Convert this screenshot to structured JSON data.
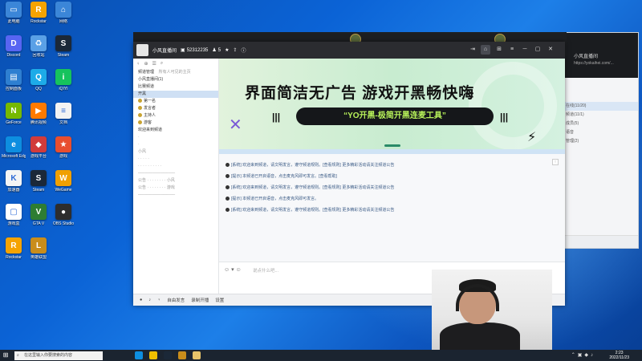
{
  "desktop_icons": [
    {
      "label": "此电脑",
      "color": "#3b86d8",
      "glyph": "▭"
    },
    {
      "label": "Rockstar",
      "color": "#f5a300",
      "glyph": "R"
    },
    {
      "label": "网络",
      "color": "#3b86d8",
      "glyph": "⌂"
    },
    {
      "label": "Discord",
      "color": "#5865f2",
      "glyph": "D"
    },
    {
      "label": "回收站",
      "color": "#5aa0e6",
      "glyph": "♻"
    },
    {
      "label": "Steam",
      "color": "#1b2838",
      "glyph": "S"
    },
    {
      "label": "控制面板",
      "color": "#2e7fd1",
      "glyph": "▤"
    },
    {
      "label": "QQ",
      "color": "#1dabe8",
      "glyph": "Q"
    },
    {
      "label": "iQIYI",
      "color": "#16c35d",
      "glyph": "i"
    },
    {
      "label": "GeForce",
      "color": "#76b900",
      "glyph": "N"
    },
    {
      "label": "腾讯视频",
      "color": "#ff7a00",
      "glyph": "▶"
    },
    {
      "label": "文档",
      "color": "#f3f3f3",
      "glyph": "≡"
    },
    {
      "label": "Microsoft Edge",
      "color": "#0d8ee0",
      "glyph": "e"
    },
    {
      "label": "游戏平台",
      "color": "#d13b3b",
      "glyph": "◆"
    },
    {
      "label": "游戏",
      "color": "#e84e2f",
      "glyph": "★"
    },
    {
      "label": "加速器",
      "color": "#f5f5f5",
      "glyph": "K"
    },
    {
      "label": "Steam",
      "color": "#1b2838",
      "glyph": "S"
    },
    {
      "label": "WeGame",
      "color": "#f0a000",
      "glyph": "W"
    },
    {
      "label": "游戏盒",
      "color": "#ffffff",
      "glyph": "▢"
    },
    {
      "label": "GTA V",
      "color": "#2e7d32",
      "glyph": "V"
    },
    {
      "label": "OBS Studio",
      "color": "#2d2d2d",
      "glyph": "●"
    },
    {
      "label": "Rockstar",
      "color": "#f5a300",
      "glyph": "R"
    },
    {
      "label": "英雄联盟",
      "color": "#c98d1b",
      "glyph": "L"
    }
  ],
  "app": {
    "room_name": "小风直播间",
    "room_id": "52312235",
    "online_count": "5",
    "side_tools": [
      "♀",
      "⊕",
      "☰",
      "⌕"
    ],
    "channel_header": "频道管理",
    "channel_header_right": "所有人可见的主页",
    "tree": [
      {
        "text": "小风直播间(1)",
        "cls": ""
      },
      {
        "text": "比赛频道",
        "cls": ""
      },
      {
        "text": "开黑",
        "cls": "sel"
      },
      {
        "text": "第一名",
        "cls": ""
      },
      {
        "text": "发言者",
        "cls": ""
      },
      {
        "text": "主持人",
        "cls": ""
      },
      {
        "text": "游客",
        "cls": ""
      },
      {
        "text": "欢迎来到频道",
        "cls": ""
      },
      {
        "text": "·",
        "cls": "dim"
      },
      {
        "text": "·",
        "cls": "dim"
      },
      {
        "text": "小风",
        "cls": "dim"
      },
      {
        "text": "· · · · ·",
        "cls": "dim"
      },
      {
        "text": "· · · · · · · · · ·",
        "cls": "dim"
      },
      {
        "text": "─────────────",
        "cls": "dim"
      },
      {
        "text": "公告 · · · · · · · · 小风",
        "cls": "dim"
      },
      {
        "text": "公告 · · · · · · · · 游戏",
        "cls": "dim"
      },
      {
        "text": "─────────────",
        "cls": "dim"
      }
    ],
    "banner": {
      "title": "界面简洁无广告  游戏开黑畅快嗨",
      "slogan": "“YO开黑-极简开黑连麦工具”"
    },
    "messages": [
      "[系统] 欢迎来到频道，请文明发言，遵守频道规则。[查看规则] 更多精彩活动请关注频道公告",
      "[提示] 本频道已开启语音，点击麦克风即可发言。[查看帮助]",
      "[系统] 欢迎来到频道，请文明发言，遵守频道规则。[查看规则] 更多精彩活动请关注频道公告",
      "[提示] 本频道已开启语音，点击麦克风即可发言。",
      "[系统] 欢迎来到频道，请文明发言，遵守频道规则。[查看规则] 更多精彩活动请关注频道公告"
    ],
    "input_placeholder": "说点什么吧...",
    "status": {
      "mic": "自由发言",
      "record": "录制开播",
      "settings": "设置"
    }
  },
  "right_panel": {
    "title": "小风直播间",
    "url": "https://yokaihei.com/...",
    "rows": [
      "在线(11/20)",
      "频道(11/1)",
      "成员(5)",
      "语音",
      "管理(2)"
    ]
  },
  "taskbar": {
    "search_placeholder": "在这里输入你要搜索的内容",
    "time": "2:23",
    "date": "2022/11/23"
  }
}
